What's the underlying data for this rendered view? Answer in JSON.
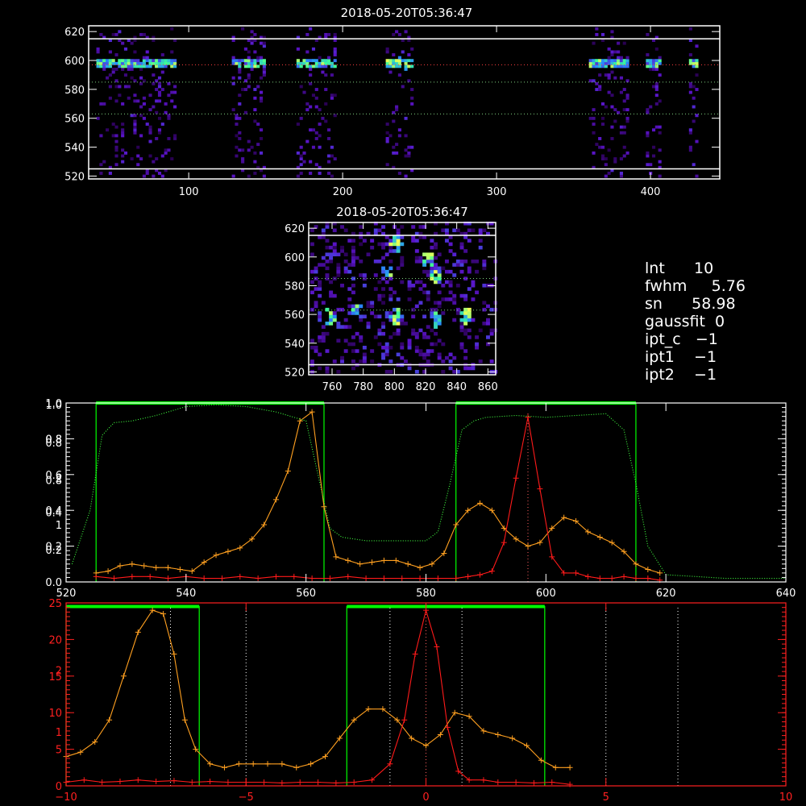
{
  "colors": {
    "background": "#000000",
    "axis": "#ffffff",
    "bottom_axis": "#ff2020",
    "orange": "#ffa020",
    "red": "#ff1a1a",
    "green_box": "#00ff00",
    "green_dotted": "#40ff40"
  },
  "info_panel": [
    {
      "key": "lnt",
      "value": "10",
      "text": "lnt      10"
    },
    {
      "key": "fwhm",
      "value": "5.76",
      "text": "fwhm     5.76"
    },
    {
      "key": "sn",
      "value": "58.98",
      "text": "sn      58.98"
    },
    {
      "key": "gaussfit",
      "value": "0",
      "text": "gaussfit  0"
    },
    {
      "key": "ipt_c",
      "value": "-1",
      "text": "ipt_c   −1"
    },
    {
      "key": "ipt1",
      "value": "-1",
      "text": "ipt1    −1"
    },
    {
      "key": "ipt2",
      "value": "-1",
      "text": "ipt2    −1"
    }
  ],
  "chart_data": [
    {
      "id": "spectrogram-top",
      "type": "heatmap",
      "title": "2018-05-20T05:36:47",
      "xlim": [
        35,
        445
      ],
      "ylim": [
        518,
        624
      ],
      "x_ticks": [
        "100",
        "200",
        "300",
        "400"
      ],
      "y_ticks": [
        "520",
        "540",
        "560",
        "580",
        "600",
        "620"
      ],
      "reference_lines_y": [
        525,
        563,
        585,
        597,
        615
      ],
      "bright_column_ranges": [
        [
          40,
          90
        ],
        [
          128,
          148
        ],
        [
          170,
          195
        ],
        [
          228,
          245
        ],
        [
          360,
          385
        ],
        [
          397,
          405
        ],
        [
          425,
          430
        ]
      ],
      "emission_row_y": 597
    },
    {
      "id": "spectrogram-zoom",
      "type": "heatmap",
      "title": "2018-05-20T05:36:47",
      "xlim": [
        745,
        865
      ],
      "ylim": [
        518,
        624
      ],
      "x_ticks": [
        "760",
        "780",
        "800",
        "820",
        "840",
        "860"
      ],
      "y_ticks": [
        "520",
        "540",
        "560",
        "580",
        "600",
        "620"
      ],
      "reference_lines_y": [
        525,
        563,
        585,
        615
      ],
      "bright_spots": [
        [
          757,
          557
        ],
        [
          775,
          560
        ],
        [
          800,
          558
        ],
        [
          825,
          555
        ],
        [
          845,
          558
        ],
        [
          795,
          590
        ],
        [
          820,
          597
        ],
        [
          800,
          608
        ],
        [
          825,
          585
        ]
      ]
    },
    {
      "id": "profile-panel",
      "type": "line",
      "xlim": [
        520,
        640
      ],
      "ylim": [
        0,
        1.0
      ],
      "x_ticks": [
        "520",
        "540",
        "560",
        "580",
        "600",
        "620",
        "640"
      ],
      "y_ticks": [
        "0.0",
        "0.2",
        "0.4",
        "0.6",
        "0.8",
        "1.0"
      ],
      "extra_left_labels": [
        {
          "text": "2",
          "value": 0.58
        },
        {
          "text": "1",
          "value": 0.32
        },
        {
          "text": "0.8",
          "value": 0.78
        },
        {
          "text": "0.8",
          "value": 0.57
        },
        {
          "text": "0.4",
          "value": 0.39
        },
        {
          "text": "0.2",
          "value": 0.18
        },
        {
          "text": "1.0",
          "value": 0.99
        },
        {
          "text": "0.8",
          "value": 0.8
        }
      ],
      "green_boxes": [
        [
          525,
          563,
          1.0
        ],
        [
          585,
          615,
          1.0
        ]
      ],
      "vertical_marker_x": 597,
      "series": [
        {
          "color": "orange",
          "x": [
            525,
            527,
            529,
            531,
            533,
            535,
            537,
            539,
            541,
            543,
            545,
            547,
            549,
            551,
            553,
            555,
            557,
            559,
            561,
            563,
            565,
            567,
            569,
            571,
            573,
            575,
            577,
            579,
            581,
            583,
            585,
            587,
            589,
            591,
            593,
            595,
            597,
            599,
            601,
            603,
            605,
            607,
            609,
            611,
            613,
            615,
            617,
            619
          ],
          "y": [
            0.05,
            0.06,
            0.09,
            0.1,
            0.09,
            0.08,
            0.08,
            0.07,
            0.06,
            0.11,
            0.15,
            0.17,
            0.19,
            0.24,
            0.32,
            0.46,
            0.62,
            0.9,
            0.95,
            0.42,
            0.14,
            0.12,
            0.1,
            0.11,
            0.12,
            0.12,
            0.1,
            0.08,
            0.1,
            0.16,
            0.32,
            0.4,
            0.44,
            0.4,
            0.3,
            0.24,
            0.2,
            0.22,
            0.3,
            0.36,
            0.34,
            0.28,
            0.25,
            0.22,
            0.17,
            0.1,
            0.07,
            0.05
          ]
        },
        {
          "color": "red",
          "x": [
            525,
            528,
            531,
            534,
            537,
            540,
            543,
            546,
            549,
            552,
            555,
            558,
            561,
            564,
            567,
            570,
            573,
            576,
            579,
            582,
            585,
            587,
            589,
            591,
            593,
            595,
            597,
            599,
            601,
            603,
            605,
            607,
            609,
            611,
            613,
            615,
            617,
            619
          ],
          "y": [
            0.03,
            0.02,
            0.03,
            0.03,
            0.02,
            0.03,
            0.02,
            0.02,
            0.03,
            0.02,
            0.03,
            0.03,
            0.02,
            0.02,
            0.03,
            0.02,
            0.02,
            0.02,
            0.02,
            0.02,
            0.02,
            0.03,
            0.04,
            0.06,
            0.22,
            0.58,
            0.92,
            0.52,
            0.14,
            0.05,
            0.05,
            0.03,
            0.02,
            0.02,
            0.03,
            0.02,
            0.02,
            0.01
          ]
        },
        {
          "color": "green_dotted",
          "x": [
            521,
            524,
            526,
            528,
            531,
            535,
            540,
            545,
            550,
            555,
            560,
            562,
            564,
            566,
            568,
            570,
            575,
            580,
            582,
            584,
            586,
            588,
            590,
            595,
            600,
            605,
            610,
            613,
            615,
            617,
            620,
            625,
            630,
            640
          ],
          "y": [
            0.1,
            0.4,
            0.82,
            0.89,
            0.9,
            0.93,
            0.98,
            0.99,
            0.98,
            0.95,
            0.9,
            0.6,
            0.3,
            0.25,
            0.24,
            0.23,
            0.23,
            0.23,
            0.28,
            0.55,
            0.85,
            0.9,
            0.92,
            0.93,
            0.92,
            0.93,
            0.94,
            0.85,
            0.55,
            0.2,
            0.04,
            0.03,
            0.02,
            0.02
          ]
        }
      ]
    },
    {
      "id": "velocity-panel",
      "type": "line",
      "xlim": [
        -10,
        10
      ],
      "ylim": [
        0,
        25
      ],
      "x_ticks": [
        "−10",
        "−5",
        "0",
        "5",
        "10"
      ],
      "y_ticks": [
        "0",
        "5",
        "10",
        "15",
        "20",
        "25"
      ],
      "extra_left_labels": [
        {
          "text": "1",
          "value": 7.4
        },
        {
          "text": "2",
          "value": 15.8
        }
      ],
      "green_boxes": [
        [
          -10,
          -6.3,
          24.5
        ],
        [
          -2.2,
          3.3,
          24.5
        ]
      ],
      "dotted_verticals": [
        -7.1,
        -5.0,
        -1.0,
        0.0,
        1.0,
        5.0,
        7.0
      ],
      "series": [
        {
          "color": "orange",
          "x": [
            -10,
            -9.6,
            -9.2,
            -8.8,
            -8.4,
            -8.0,
            -7.6,
            -7.3,
            -7.0,
            -6.7,
            -6.4,
            -6.0,
            -5.6,
            -5.2,
            -4.8,
            -4.4,
            -4.0,
            -3.6,
            -3.2,
            -2.8,
            -2.4,
            -2.0,
            -1.6,
            -1.2,
            -0.8,
            -0.4,
            0.0,
            0.4,
            0.8,
            1.2,
            1.6,
            2.0,
            2.4,
            2.8,
            3.2,
            3.6,
            4.0
          ],
          "y": [
            4.0,
            4.6,
            6.0,
            9.0,
            15.0,
            21.0,
            24.0,
            23.5,
            18.0,
            9.0,
            5.0,
            3.0,
            2.5,
            3.0,
            3.0,
            3.0,
            3.0,
            2.5,
            3.0,
            4.0,
            6.5,
            9.0,
            10.5,
            10.5,
            9.0,
            6.5,
            5.5,
            7.0,
            10.0,
            9.5,
            7.5,
            7.0,
            6.5,
            5.5,
            3.5,
            2.5,
            2.5
          ]
        },
        {
          "color": "red",
          "x": [
            -10,
            -9.5,
            -9.0,
            -8.5,
            -8.0,
            -7.5,
            -7.0,
            -6.5,
            -6.0,
            -5.5,
            -5.0,
            -4.5,
            -4.0,
            -3.5,
            -3.0,
            -2.5,
            -2.0,
            -1.5,
            -1.0,
            -0.6,
            -0.3,
            0.0,
            0.3,
            0.6,
            0.9,
            1.2,
            1.6,
            2.0,
            2.5,
            3.0,
            3.5,
            4.0
          ],
          "y": [
            0.5,
            0.8,
            0.5,
            0.6,
            0.8,
            0.6,
            0.7,
            0.5,
            0.6,
            0.5,
            0.5,
            0.5,
            0.4,
            0.5,
            0.5,
            0.4,
            0.5,
            0.8,
            3.0,
            9.0,
            18.0,
            24.0,
            19.0,
            8.0,
            2.0,
            0.8,
            0.8,
            0.5,
            0.5,
            0.4,
            0.5,
            0.2
          ]
        }
      ]
    }
  ]
}
